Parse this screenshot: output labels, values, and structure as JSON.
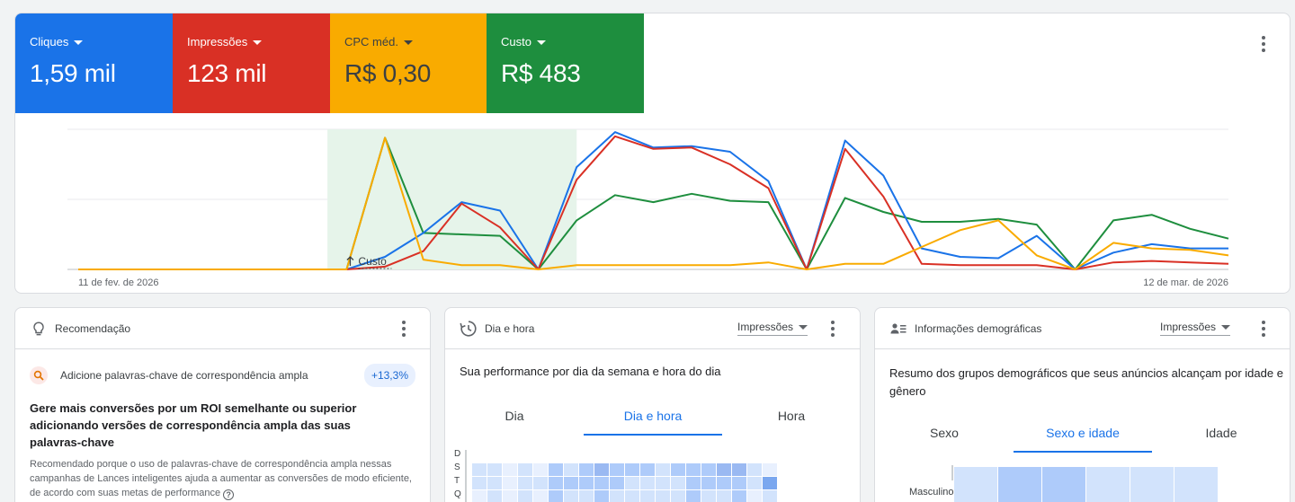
{
  "performance": {
    "metrics": [
      {
        "id": "cliques",
        "label": "Cliques",
        "value": "1,59 mil",
        "color": "#1a73e8"
      },
      {
        "id": "impressoes",
        "label": "Impressões",
        "value": "123 mil",
        "color": "#d93025"
      },
      {
        "id": "cpc",
        "label": "CPC méd.",
        "value": "R$ 0,30",
        "color": "#f9ab00"
      },
      {
        "id": "custo",
        "label": "Custo",
        "value": "R$ 483",
        "color": "#1e8e3e"
      }
    ],
    "menu_icon": "more-vert-icon",
    "chart": {
      "start_label": "11 de fev. de 2026",
      "end_label": "12 de mar. de 2026",
      "highlight_label": "Custo",
      "highlight_range": [
        7,
        13
      ]
    }
  },
  "chart_data": {
    "type": "line",
    "x_start": "11 de fev. de 2026",
    "x_end": "12 de mar. de 2026",
    "ylim": [
      0,
      100
    ],
    "grid": true,
    "series": [
      {
        "color": "#1e8e3e",
        "values": [
          0,
          0,
          0,
          0,
          0,
          0,
          0,
          0,
          94,
          26,
          25,
          24,
          0,
          35,
          53,
          48,
          54,
          49,
          48,
          0,
          51,
          41,
          34,
          34,
          36,
          32,
          0,
          35,
          39,
          29,
          22
        ]
      },
      {
        "color": "#1a73e8",
        "values": [
          0,
          0,
          0,
          0,
          0,
          0,
          0,
          0,
          9,
          26,
          48,
          42,
          0,
          73,
          98,
          87,
          88,
          84,
          63,
          0,
          92,
          67,
          15,
          9,
          8,
          24,
          0,
          12,
          18,
          15,
          15
        ]
      },
      {
        "color": "#d93025",
        "values": [
          0,
          0,
          0,
          0,
          0,
          0,
          0,
          0,
          2,
          13,
          47,
          30,
          0,
          64,
          95,
          86,
          87,
          75,
          58,
          0,
          86,
          52,
          4,
          3,
          3,
          3,
          0,
          5,
          6,
          5,
          4
        ]
      },
      {
        "color": "#f9ab00",
        "values": [
          0,
          0,
          0,
          0,
          0,
          0,
          0,
          0,
          94,
          7,
          3,
          3,
          0,
          3,
          3,
          3,
          3,
          3,
          5,
          0,
          4,
          4,
          16,
          28,
          35,
          10,
          0,
          19,
          15,
          14,
          10
        ]
      }
    ]
  },
  "recommendation": {
    "title": "Recomendação",
    "type_label": "Adicione palavras-chave de correspondência ampla",
    "badge": "+13,3%",
    "headline": "Gere mais conversões por um ROI semelhante ou superior adicionando versões de correspondência ampla das suas palavras-chave",
    "description": "Recomendado porque o uso de palavras-chave de correspondência ampla nessas campanhas de Lances inteligentes ajuda a aumentar as conversões de modo eficiente, de acordo com suas metas de performance",
    "icons": {
      "header": "lightbulb-icon",
      "type": "search-icon",
      "help": "help-icon"
    }
  },
  "day_hour": {
    "title": "Dia e hora",
    "dropdown": "Impressões",
    "subtitle": "Sua performance por dia da semana e hora do dia",
    "tabs": [
      {
        "label": "Dia",
        "active": false
      },
      {
        "label": "Dia e hora",
        "active": true
      },
      {
        "label": "Hora",
        "active": false
      }
    ],
    "days": [
      "D",
      "S",
      "T",
      "Q"
    ],
    "heat": [
      [
        1,
        1,
        0,
        1,
        0,
        2,
        1,
        2,
        3,
        2,
        2,
        2,
        1,
        2,
        2,
        2,
        3,
        3,
        1,
        0
      ],
      [
        1,
        1,
        0,
        1,
        1,
        2,
        2,
        2,
        2,
        2,
        1,
        1,
        1,
        1,
        2,
        2,
        2,
        2,
        1,
        4
      ],
      [
        0,
        1,
        0,
        1,
        0,
        2,
        1,
        1,
        2,
        1,
        1,
        1,
        1,
        1,
        2,
        1,
        1,
        2,
        0,
        1
      ]
    ],
    "icon": "schedule-icon"
  },
  "demographics": {
    "title": "Informações demográficas",
    "dropdown": "Impressões",
    "subtitle": "Resumo dos grupos demográficos que seus anúncios alcançam por idade e gênero",
    "tabs": [
      {
        "label": "Sexo",
        "active": false
      },
      {
        "label": "Sexo e idade",
        "active": true
      },
      {
        "label": "Idade",
        "active": false
      }
    ],
    "row_label": "Masculino",
    "heat": [
      1,
      2,
      2,
      1,
      1,
      1
    ],
    "icon": "people-icon"
  }
}
